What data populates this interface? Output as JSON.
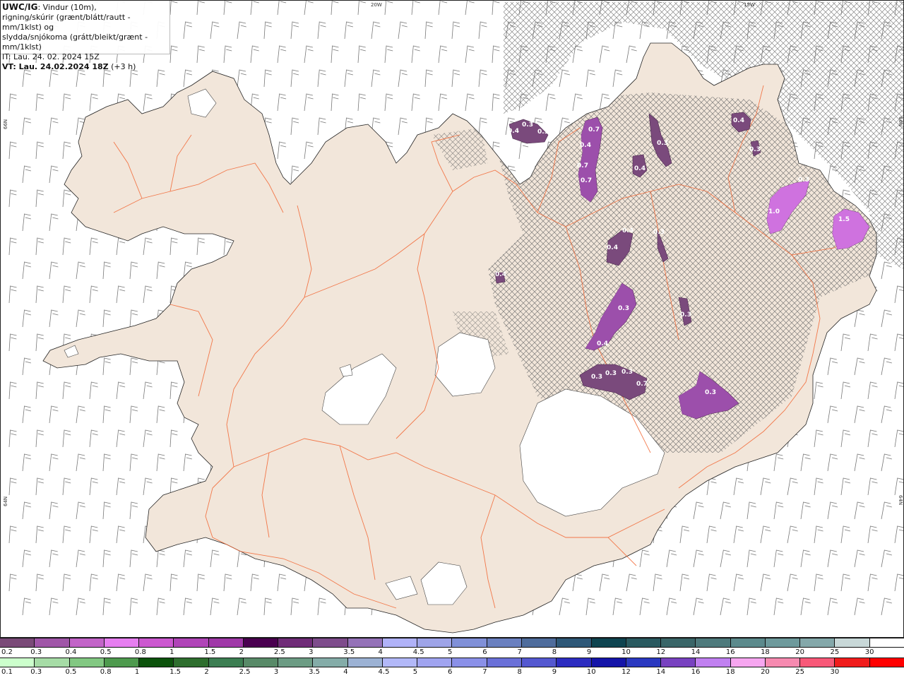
{
  "header": {
    "model": "UWC/IG",
    "desc1": ": Vindur (10m),",
    "desc2": "rigning/skúrir (grænt/blátt/rautt - mm/1klst) og",
    "desc3": "slydda/snjókoma (grátt/bleikt/grænt - mm/1klst)",
    "it": "IT: Lau. 24. 02. 2024 15Z",
    "vt_bold": "VT: Lau. 24.02.2024 18Z",
    "vt_suffix": " (+3 h)"
  },
  "grid_labels": {
    "top_20w": "20W",
    "top_15w": "15W",
    "left_66n": "66N",
    "right_66n": "66N",
    "left_64n": "64N",
    "right_64n": "64N"
  },
  "precip_labels": [
    "0.4",
    "0.3",
    "0.3",
    "0.7",
    "0.4",
    "0.7",
    "0.7",
    "0.3",
    "0.4",
    "0.4",
    "0.3",
    "1.0",
    "0.3",
    "1.5",
    "0.4",
    "0.4",
    "0.3",
    "0.3",
    "0.3",
    "0.4",
    "0.4",
    "0.3",
    "0.3",
    "0.3",
    "0.7",
    "0.3"
  ],
  "snow_scale": {
    "labels": [
      "0.2",
      "0.3",
      "0.4",
      "0.5",
      "0.8",
      "1",
      "1.5",
      "2",
      "2.5",
      "3",
      "3.5",
      "4",
      "4.5",
      "5",
      "6",
      "7",
      "8",
      "9",
      "10",
      "12",
      "14",
      "16",
      "18",
      "20",
      "25",
      "30"
    ],
    "colors": [
      "#7a4a78",
      "#a056a8",
      "#c264c8",
      "#e67ef0",
      "#cc58d0",
      "#b044b8",
      "#a038a8",
      "#4a0050",
      "#702c78",
      "#7e4c8c",
      "#9472b8",
      "#b0b2f8",
      "#9ea4e8",
      "#8090d8",
      "#6a80c0",
      "#4e6c9c",
      "#2e5878",
      "#0e4450",
      "#2a5a60",
      "#3a6668",
      "#4e7a7c",
      "#5c8a8c",
      "#6e9a9c",
      "#84a8aa",
      "#c8d8d8",
      "#ffffff"
    ]
  },
  "rain_scale": {
    "labels": [
      "0.1",
      "0.3",
      "0.5",
      "0.8",
      "1",
      "1.5",
      "2",
      "2.5",
      "3",
      "3.5",
      "4",
      "4.5",
      "5",
      "6",
      "7",
      "8",
      "9",
      "10",
      "12",
      "14",
      "16",
      "18",
      "20",
      "25",
      "30"
    ],
    "colors": [
      "#ccffcc",
      "#a6dca6",
      "#82c882",
      "#4e9a4e",
      "#0c520c",
      "#2e6e2e",
      "#3c7e52",
      "#588a68",
      "#6c9c84",
      "#84aca8",
      "#9cb2d4",
      "#b2b8f8",
      "#a0a4f0",
      "#8a90e8",
      "#6a70d8",
      "#5458d0",
      "#2c2cc0",
      "#1414a8",
      "#2a38c0",
      "#7842c0",
      "#c080f0",
      "#f6a6f0",
      "#f68ab0",
      "#f85878",
      "#f01c1c",
      "#ff0000"
    ]
  },
  "colors": {
    "land": "#f2e6da",
    "road": "#f26430",
    "glacier": "#ffffff",
    "sleet_hatch": "#555555",
    "snow_low": "#7a4a7c",
    "snow_mid": "#a050b0",
    "snow_high": "#e07ef0",
    "barb": "#777777"
  }
}
